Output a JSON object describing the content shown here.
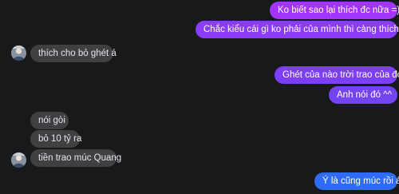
{
  "colors": {
    "background": "#18191a",
    "incoming_bubble": "#3e4042",
    "outgoing_top": "#a033ff",
    "outgoing_mid": "#7b3ff2",
    "outgoing_bottom": "#2e6cf6"
  },
  "messages": [
    {
      "id": "m1",
      "direction": "outgoing",
      "text": "Ko biết sao lại thích đc nữa =)))"
    },
    {
      "id": "m2",
      "direction": "outgoing",
      "text": "Chắc kiểu cái gì ko phải của mình thì càng thích =))))"
    },
    {
      "id": "m3",
      "direction": "incoming",
      "text": "thích cho bỏ ghét á"
    },
    {
      "id": "m4",
      "direction": "outgoing",
      "text": "Ghét của nào trời trao của đó"
    },
    {
      "id": "m5",
      "direction": "outgoing",
      "text": "Anh nói đó ^^"
    },
    {
      "id": "m6",
      "direction": "incoming",
      "text": "nói gòi"
    },
    {
      "id": "m7",
      "direction": "incoming",
      "text": "bỏ 10 tỷ ra"
    },
    {
      "id": "m8",
      "direction": "incoming",
      "text": "tiền trao múc Quang"
    },
    {
      "id": "m9",
      "direction": "outgoing",
      "text": "Ý là cũng múc rồi á"
    }
  ],
  "avatar": {
    "icon": "user-avatar-photo"
  }
}
